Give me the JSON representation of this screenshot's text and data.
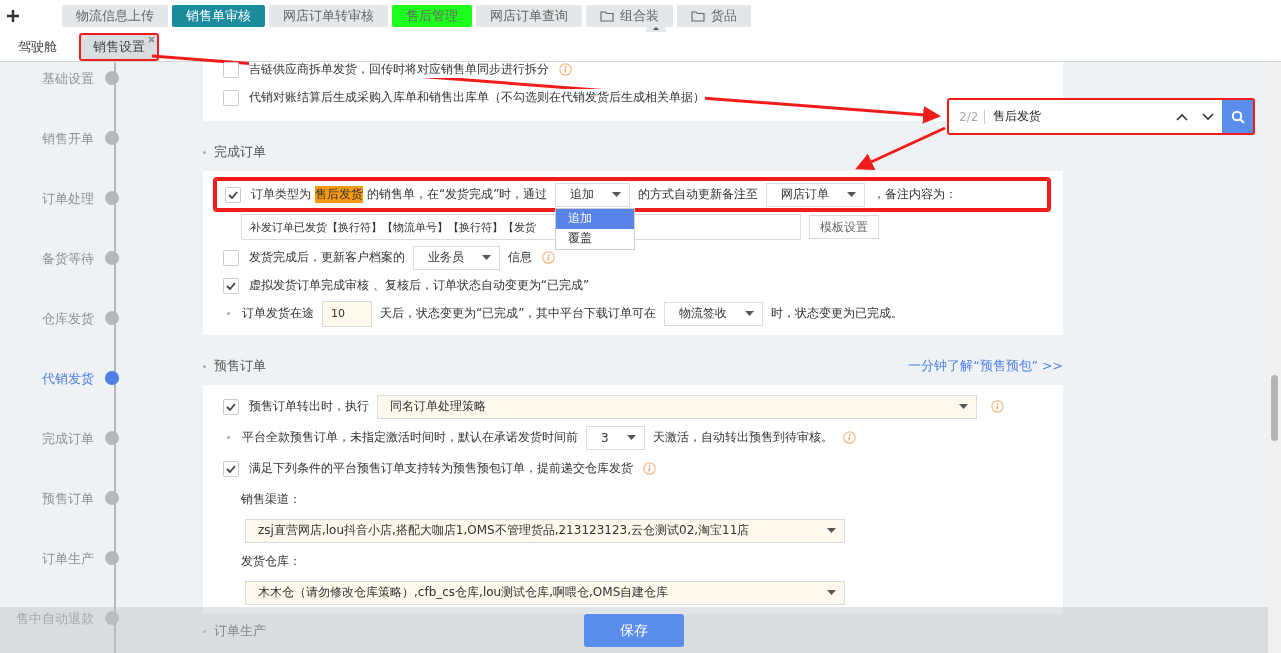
{
  "top_tabs": [
    {
      "label": "物流信息上传",
      "kind": "tab",
      "color": "#e4e7ea"
    },
    {
      "label": "销售单审核",
      "kind": "tab",
      "color": "#1a8b9d"
    },
    {
      "label": "网店订单转审核",
      "kind": "tab",
      "color": "#e4e7ea"
    },
    {
      "label": "售后管理",
      "kind": "tab",
      "color": "#1cff1c"
    },
    {
      "label": "网店订单查询",
      "kind": "tab",
      "color": "#e4e7ea"
    },
    {
      "label": "组合装",
      "kind": "folder",
      "color": "#e4e7ea"
    },
    {
      "label": "货品",
      "kind": "folder",
      "color": "#e4e7ea"
    }
  ],
  "page_tabs": [
    {
      "label": "驾驶舱",
      "selected": false,
      "highlighted": false
    },
    {
      "label": "销售设置",
      "selected": true,
      "highlighted": true
    }
  ],
  "timeline": [
    {
      "label": "基础设置",
      "selected": false
    },
    {
      "label": "销售开单",
      "selected": false
    },
    {
      "label": "订单处理",
      "selected": false
    },
    {
      "label": "备货等待",
      "selected": false
    },
    {
      "label": "仓库发货",
      "selected": false
    },
    {
      "label": "代销发货",
      "selected": true
    },
    {
      "label": "完成订单",
      "selected": false
    },
    {
      "label": "预售订单",
      "selected": false
    },
    {
      "label": "订单生产",
      "selected": false
    },
    {
      "label": "售中自动退款",
      "selected": false
    }
  ],
  "sections": [
    {
      "rows": [
        {
          "kind": "checkbox",
          "checked": false,
          "highlighted": false,
          "parts": [
            {
              "kind": "text",
              "text": "吉链供应商拆单发货，回传时将对应销售单同步进行拆分"
            },
            {
              "kind": "info"
            }
          ]
        },
        {
          "kind": "checkbox",
          "checked": false,
          "highlighted": false,
          "parts": [
            {
              "kind": "text",
              "text": "代销对账结算后生成采购入库单和销售出库单（不勾选则在代销发货后生成相关单据）"
            }
          ]
        }
      ]
    },
    {
      "title": "完成订单",
      "rows": [
        {
          "kind": "checkbox",
          "checked": true,
          "highlighted": true,
          "parts": [
            {
              "kind": "text",
              "text": "订单类型为"
            },
            {
              "kind": "mark",
              "text": "售后发货"
            },
            {
              "kind": "text",
              "text": "的销售单，在“发货完成”时，通过"
            },
            {
              "kind": "select",
              "value": "追加",
              "open": true,
              "options": [
                {
                  "label": "追加",
                  "selected": true
                },
                {
                  "label": "覆盖",
                  "selected": false
                }
              ]
            },
            {
              "kind": "text",
              "text": "的方式自动更新备注至"
            },
            {
              "kind": "select",
              "value": "网店订单"
            },
            {
              "kind": "text",
              "text": "，备注内容为："
            }
          ]
        },
        {
          "kind": "template",
          "highlighted": false,
          "parts": [
            {
              "kind": "input",
              "value": "补发订单已发货【换行符】【物流单号】【换行符】【发货"
            },
            {
              "kind": "button",
              "text": "模板设置"
            }
          ]
        },
        {
          "kind": "checkbox",
          "checked": false,
          "highlighted": false,
          "parts": [
            {
              "kind": "text",
              "text": "发货完成后，更新客户档案的"
            },
            {
              "kind": "select",
              "value": "业务员"
            },
            {
              "kind": "text",
              "text": "信息"
            },
            {
              "kind": "info"
            }
          ]
        },
        {
          "kind": "checkbox",
          "checked": true,
          "highlighted": false,
          "parts": [
            {
              "kind": "text",
              "text": "虚拟发货订单完成审核 、复核后，订单状态自动变更为“已完成”"
            }
          ]
        },
        {
          "kind": "bullet",
          "highlighted": false,
          "parts": [
            {
              "kind": "text",
              "text": "订单发货在途"
            },
            {
              "kind": "input",
              "value": "10"
            },
            {
              "kind": "text",
              "text": "天后，状态变更为“已完成”，其中平台下载订单可在"
            },
            {
              "kind": "select",
              "value": "物流签收"
            },
            {
              "kind": "text",
              "text": "时，状态变更为已完成。"
            }
          ]
        }
      ]
    },
    {
      "title": "预售订单",
      "link": "一分钟了解“预售预包”  >>",
      "rows": [
        {
          "kind": "checkbox",
          "checked": true,
          "highlighted": false,
          "parts": [
            {
              "kind": "text",
              "text": "预售订单转出时，执行"
            },
            {
              "kind": "wide-select",
              "value": "同名订单处理策略"
            },
            {
              "kind": "info"
            }
          ]
        },
        {
          "kind": "bullet",
          "highlighted": false,
          "parts": [
            {
              "kind": "text",
              "text": "平台全款预售订单，未指定激活时间时，默认在承诺发货时间前"
            },
            {
              "kind": "select",
              "value": "3"
            },
            {
              "kind": "text",
              "text": "天激活，自动转出预售到待审核。"
            },
            {
              "kind": "info"
            }
          ]
        },
        {
          "kind": "checkbox",
          "checked": true,
          "highlighted": false,
          "parts": [
            {
              "kind": "text",
              "text": "满足下列条件的平台预售订单支持转为预售预包订单，提前递交仓库发货"
            },
            {
              "kind": "info"
            }
          ]
        },
        {
          "kind": "label",
          "highlighted": false,
          "parts": [
            {
              "kind": "text",
              "text": "销售渠道："
            }
          ]
        },
        {
          "kind": "label",
          "highlighted": false,
          "parts": [
            {
              "kind": "wide-select",
              "value": "zsj直营网店,lou抖音小店,搭配大咖店1,OMS不管理货品,213123123,云仓测试02,淘宝11店"
            }
          ]
        },
        {
          "kind": "label",
          "highlighted": false,
          "parts": [
            {
              "kind": "text",
              "text": "发货仓库："
            }
          ]
        },
        {
          "kind": "label",
          "highlighted": false,
          "parts": [
            {
              "kind": "wide-select",
              "value": "木木仓（请勿修改仓库策略）,cfb_cs仓库,lou测试仓库,啊喂仓,OMS自建仓库"
            }
          ]
        }
      ]
    },
    {
      "title": "订单生产"
    }
  ],
  "search": {
    "counter": "2/2",
    "query": "售后发货",
    "highlighted": true
  },
  "save_button": "保存"
}
